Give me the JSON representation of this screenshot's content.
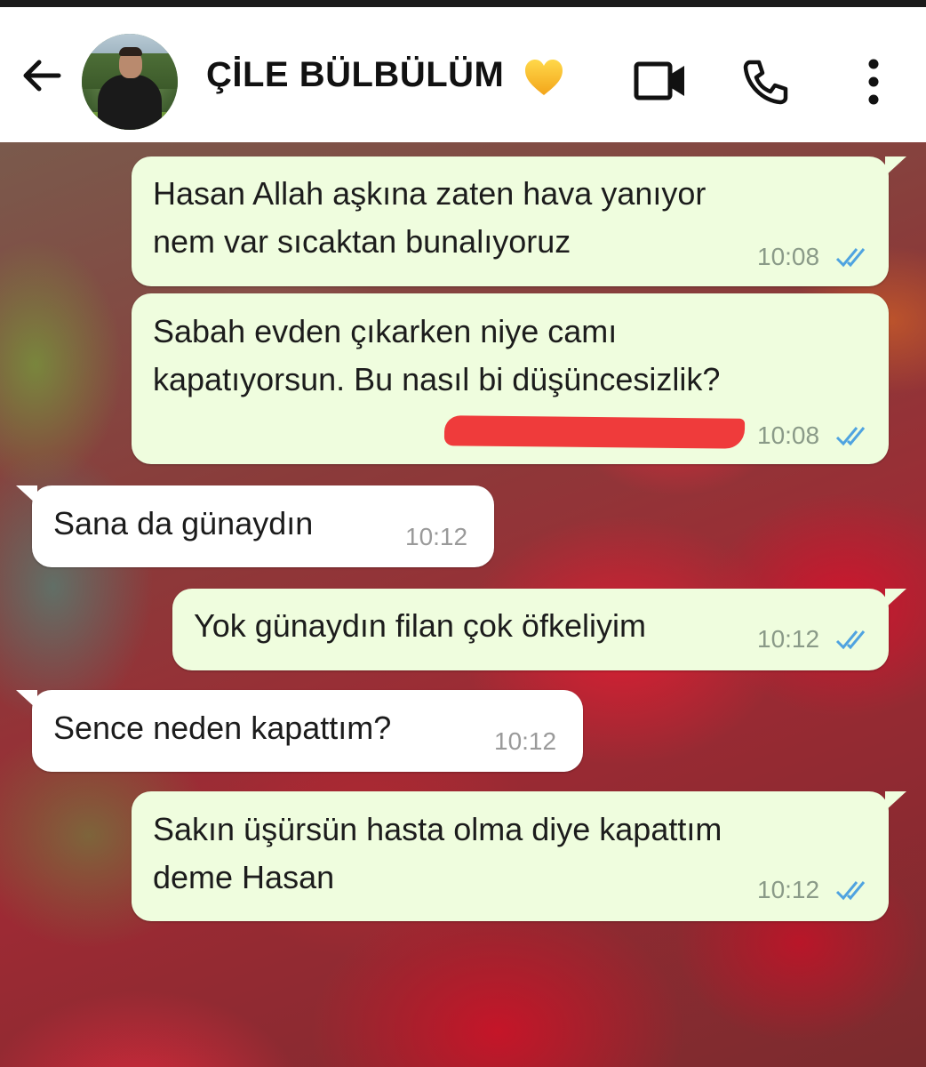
{
  "header": {
    "contact_name": "ÇİLE BÜLBÜLÜM",
    "heart_emoji": "yellow-heart-icon",
    "icons": [
      "back-arrow-icon",
      "video-call-icon",
      "phone-icon",
      "more-vert-icon"
    ]
  },
  "messages": [
    {
      "direction": "outgoing",
      "text": "Hasan Allah aşkına zaten hava yanıyor\nnem var sıcaktan bunalıyoruz",
      "time": "10:08",
      "status": "read"
    },
    {
      "direction": "outgoing",
      "text": "Sabah evden çıkarken niye camı\nkapatıyorsun. Bu nasıl bi düşüncesizlik?",
      "time": "10:08",
      "status": "read"
    },
    {
      "direction": "incoming",
      "text": "Sana da günaydın",
      "time": "10:12"
    },
    {
      "direction": "outgoing",
      "text": "Yok günaydın filan çok öfkeliyim",
      "time": "10:12",
      "status": "read"
    },
    {
      "direction": "incoming",
      "text": "Sence neden kapattım?",
      "time": "10:12"
    },
    {
      "direction": "outgoing",
      "text": "Sakın üşürsün hasta olma diye kapattım\ndeme Hasan",
      "time": "10:12",
      "status": "read"
    }
  ],
  "colors": {
    "outgoing_bubble": "#effdde",
    "incoming_bubble": "#ffffff",
    "read_ticks": "#4fa3e0",
    "redaction": "#ef3b3b"
  }
}
